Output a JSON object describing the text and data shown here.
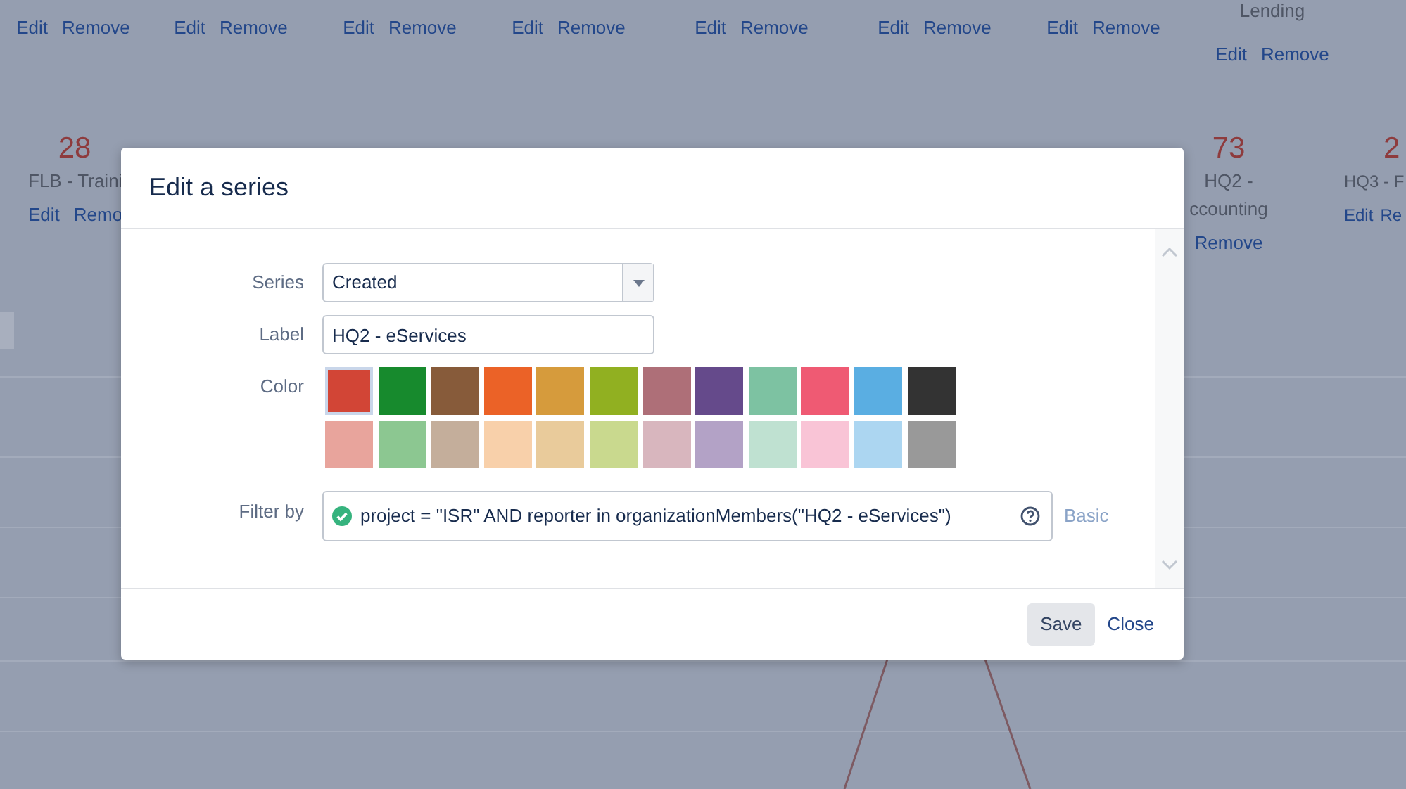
{
  "dashboard": {
    "top_items": [
      {
        "actions": [
          "Edit",
          "Remove"
        ]
      },
      {
        "actions": [
          "Edit",
          "Remove"
        ]
      },
      {
        "actions": [
          "Edit",
          "Remove"
        ]
      },
      {
        "actions": [
          "Edit",
          "Remove"
        ]
      },
      {
        "actions": [
          "Edit",
          "Remove"
        ]
      },
      {
        "actions": [
          "Edit",
          "Remove"
        ]
      },
      {
        "actions": [
          "Edit",
          "Remove"
        ]
      },
      {
        "caption": "Lending",
        "actions": [
          "Edit",
          "Remove"
        ]
      }
    ],
    "stats": [
      {
        "value": "28",
        "caption": "FLB - Traini",
        "actions": [
          "Edit",
          "Remo"
        ]
      },
      {
        "value": "73",
        "caption": "HQ2 - ccounting",
        "actions": [
          "Remove"
        ]
      },
      {
        "value": "2",
        "caption": "HQ3 - F",
        "actions": [
          "Edit",
          "Re"
        ]
      }
    ]
  },
  "dialog": {
    "title": "Edit a series",
    "series": {
      "label": "Series",
      "value": "Created"
    },
    "label_field": {
      "label": "Label",
      "value": "HQ2 - eServices"
    },
    "color_field": {
      "label": "Color",
      "swatches": [
        {
          "color": "#d24536",
          "selected": true
        },
        {
          "color": "#178a2d",
          "selected": false
        },
        {
          "color": "#875b3a",
          "selected": false
        },
        {
          "color": "#eb6227",
          "selected": false
        },
        {
          "color": "#d69b3c",
          "selected": false
        },
        {
          "color": "#91b021",
          "selected": false
        },
        {
          "color": "#ae6f78",
          "selected": false
        },
        {
          "color": "#654a8b",
          "selected": false
        },
        {
          "color": "#7dc2a2",
          "selected": false
        },
        {
          "color": "#ef5a73",
          "selected": false
        },
        {
          "color": "#5aaee2",
          "selected": false
        },
        {
          "color": "#333333",
          "selected": false
        },
        {
          "color": "#e8a49c",
          "selected": false
        },
        {
          "color": "#8cc791",
          "selected": false
        },
        {
          "color": "#c4ae9b",
          "selected": false
        },
        {
          "color": "#f8d0aa",
          "selected": false
        },
        {
          "color": "#e9cb9b",
          "selected": false
        },
        {
          "color": "#c9d98e",
          "selected": false
        },
        {
          "color": "#d8b6be",
          "selected": false
        },
        {
          "color": "#b3a2c6",
          "selected": false
        },
        {
          "color": "#bfe1d1",
          "selected": false
        },
        {
          "color": "#f9c4d6",
          "selected": false
        },
        {
          "color": "#acd6f1",
          "selected": false
        },
        {
          "color": "#999999",
          "selected": false
        }
      ]
    },
    "filter": {
      "label": "Filter by",
      "valid": true,
      "value": "project = \"ISR\" AND reporter in organizationMembers(\"HQ2 - eServices\")",
      "mode_link": "Basic"
    },
    "buttons": [
      "Save",
      "Close"
    ]
  }
}
